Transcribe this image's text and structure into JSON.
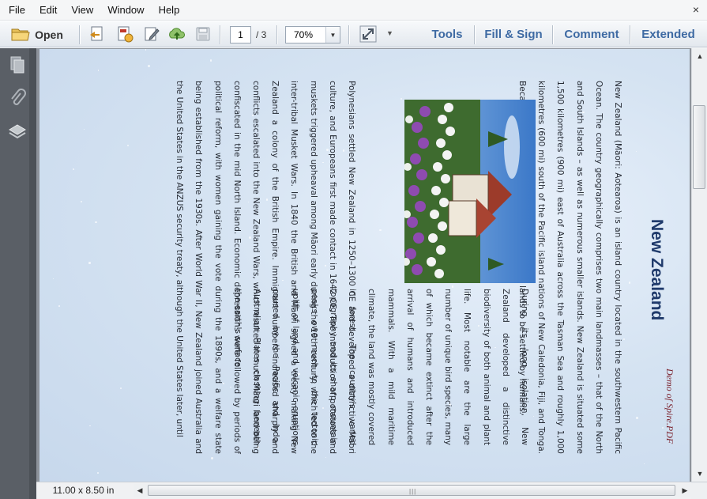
{
  "menu": {
    "file": "File",
    "edit": "Edit",
    "view": "View",
    "window": "Window",
    "help": "Help",
    "close_glyph": "×"
  },
  "toolbar": {
    "open_label": "Open",
    "page_current": "1",
    "page_total": "/ 3",
    "zoom": "70%",
    "panes": {
      "tools": "Tools",
      "fill_sign": "Fill & Sign",
      "comment": "Comment",
      "extended": "Extended"
    },
    "icons": [
      "open-folder-icon",
      "create-pdf-icon",
      "export-pdf-icon",
      "edit-pdf-icon",
      "upload-cloud-icon",
      "save-icon",
      "expand-arrows-icon"
    ]
  },
  "left_panel": {
    "icons": [
      "page-thumbnails-icon",
      "attachments-icon",
      "layers-icon"
    ]
  },
  "document": {
    "watermark": "Demo of Spire.PDF",
    "title": "New Zealand",
    "paragraph_1": "New Zealand (Māori: Aotearoa) is an island country located in the southwestern Pacific Ocean. The country geographically comprises two main landmasses – that of the North and South Islands – as well as numerous smaller islands. New Zealand is situated some 1,500 kilometres (900 mi) east of Australia across the Tasman Sea and roughly 1,000 kilometres (600 mi) south of the Pacific island nations of New Caledonia, Fiji, and Tonga. Because of its remoteness, it was one of the last lands to be settled by humans.",
    "paragraph_2": "During its long isolation, New Zealand developed a distinctive biodiversity of both animal and plant life. Most notable are the large number of unique bird species, many of which became extinct after the arrival of humans and introduced mammals. With a mild maritime climate, the land was mostly covered in forest. The country's varied topography and its sharp mountain peaks owe much to the tectonic uplift of land and volcanic eruptions caused by the Pacific and Indo-Australian Plates clashing beneath the earth's surface.",
    "paragraph_3": "Polynesians settled New Zealand in 1250–1300 CE and developed a distinctive Māori culture, and Europeans first made contact in 1642 CE. The introduction of potatoes and muskets triggered upheaval among Māori early during the 19th century, which led to the inter-tribal Musket Wars. In 1840 the British and Māori signed a treaty making New Zealand a colony of the British Empire. Immigrant numbers increased sharply and conflicts escalated into the New Zealand Wars, which resulted in much Māori land being confiscated in the mid North Island. Economic depressions were followed by periods of political reform, with women gaining the vote during the 1890s, and a welfare state being established from the 1930s. After World War II, New Zealand joined Australia and the United States in the ANZUS security treaty, although the United States later, until",
    "colors": {
      "title": "#1f3a6b",
      "watermark": "#7a1f2a",
      "page_background": "#d5e3f2"
    }
  },
  "status": {
    "page_size": "11.00 x 8.50 in",
    "h_grip": "|||"
  },
  "scroll": {
    "up": "▲",
    "down": "▼",
    "left": "◀",
    "right": "▶"
  }
}
